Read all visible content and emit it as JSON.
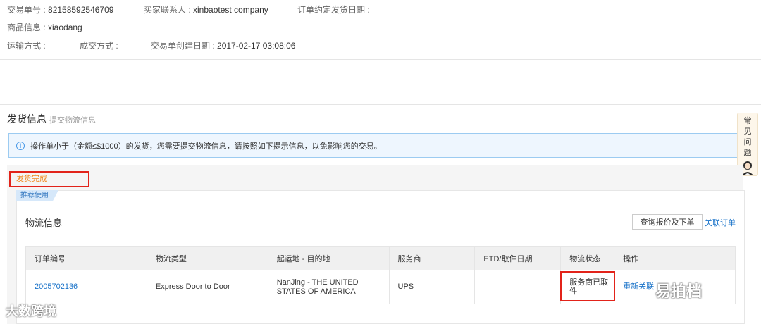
{
  "order_info": {
    "trade_no_label": "交易单号 : ",
    "trade_no": "82158592546709",
    "buyer_contact_label": "买家联系人 : ",
    "buyer_contact": "xinbaotest company",
    "ship_date_label": "订单约定发货日期 :",
    "product_label": "商品信息 : ",
    "product": "xiaodang",
    "shipping_method_label": "运输方式 :",
    "deal_method_label": "成交方式 :",
    "created_label": "交易单创建日期 : ",
    "created": "2017-02-17 03:08:06"
  },
  "shipping": {
    "title": "发货信息",
    "subtitle": "提交物流信息",
    "notice": "操作单小于（金额≤$1000）的发货，您需要提交物流信息，请按照如下提示信息，以免影响您的交易。",
    "status": "发货完成"
  },
  "faq": {
    "chars": [
      "常",
      "见",
      "问",
      "题"
    ]
  },
  "panel": {
    "tag": "推荐使用",
    "title": "物流信息",
    "quote_button": "查询报价及下单",
    "related_link": "关联订单"
  },
  "table": {
    "headers": [
      "订单编号",
      "物流类型",
      "起运地 - 目的地",
      "服务商",
      "ETD/取件日期",
      "物流状态",
      "操作"
    ],
    "row": {
      "order_no": "2005702136",
      "type": "Express Door to Door",
      "route": "NanJing - THE UNITED STATES OF AMERICA",
      "provider": "UPS",
      "etd": "",
      "status": "服务商已取件",
      "action": "重新关联"
    }
  },
  "watermarks": {
    "left": "大数跨境",
    "right": "易拍档"
  },
  "colors": {
    "link": "#1a73c9",
    "highlight_box": "#e2231a",
    "status_text": "#f08a24",
    "notice_bg": "#eef6fe"
  }
}
